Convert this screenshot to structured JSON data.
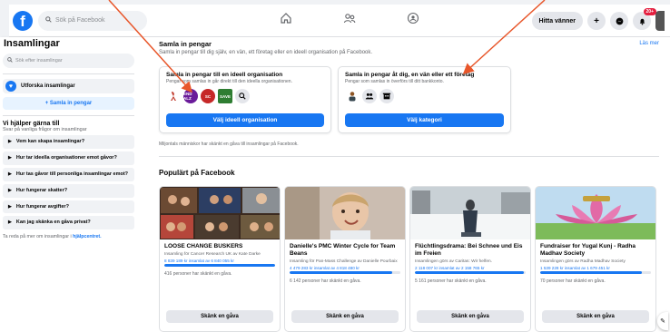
{
  "topbar": {
    "logo": "f",
    "search_placeholder": "Sök på Facebook",
    "find_friends": "Hitta vänner",
    "notification_count": "20+",
    "nav_icons": [
      "home-icon",
      "friends-icon",
      "groups-icon"
    ]
  },
  "sidebar": {
    "title": "Insamlingar",
    "search_placeholder": "Sök efter insamlingar",
    "explore_label": "Utforska insamlingar",
    "create_label": "+ Samla in pengar",
    "help_title": "Vi hjälper gärna till",
    "help_sub": "Svar på vanliga frågor om insamlingar",
    "faq": [
      "Vem kan skapa insamlingar?",
      "Hur tar ideella organisationer emot gåvor?",
      "Hur tas gåvor till personliga insamlingar emot?",
      "Hur fungerar skatter?",
      "Hur fungerar avgifter?",
      "Kan jag skänka en gåva privat?"
    ],
    "footer_text": "Ta reda på mer om insamlingar i ",
    "footer_link": "hjälpcentret."
  },
  "main": {
    "title": "Samla in pengar",
    "subtitle": "Samla in pengar till dig själv, en vän, ett företag eller en ideell organisation på Facebook.",
    "read_more": "Läs mer",
    "org_card": {
      "title": "Samla in pengar till en ideell organisation",
      "desc": "Pengar som samlas in går direkt till den ideella organisationen.",
      "logos": [
        "END ALZ",
        "SC",
        "SAVE"
      ],
      "button": "Välj ideell organisation"
    },
    "self_card": {
      "title": "Samla in pengar åt dig, en vän eller ett företag",
      "desc": "Pengar som samlas in överförs till ditt bankkonto.",
      "button": "Välj kategori"
    },
    "note": "Miljontals människor har skänkt en gåva till insamlingar på Facebook.",
    "popular_title": "Populärt på Facebook",
    "fundraisers": [
      {
        "title": "LOOSE CHANGE BUSKERS",
        "org": "Insamling för Cancer Research UK av Kate Darke",
        "raised": "8 839 189 kr insamlat av 6 840 055 kr",
        "progress": 1.0,
        "count": "416 personer har skänkt en gåva.",
        "button": "Skänk en gåva"
      },
      {
        "title": "Danielle's PMC Winter Cycle for Team Beans",
        "org": "Insamling för Pan-Mass Challenge av Danielle Pourbaix",
        "raised": "4 479 283 kr insamlat av 4 818 480 kr",
        "progress": 0.93,
        "count": "6 142 personer har skänkt en gåva.",
        "button": "Skänk en gåva"
      },
      {
        "title": "Flüchtlingsdrama: Bei Schnee und Eis im Freien",
        "org": "Insamlingen görs av Caritas: Wir helfen.",
        "raised": "2 118 007 kr insamlat av 2 158 765 kr",
        "progress": 0.98,
        "count": "5 161 personer har skänkt en gåva.",
        "button": "Skänk en gåva"
      },
      {
        "title": "Fundraiser for Yugal Kunj - Radha Madhav Society",
        "org": "Insamlingen görs av Radha Madhav Society",
        "raised": "1 539 228 kr insamlat av 1 679 451 kr",
        "progress": 0.92,
        "count": "70 personer har skänkt en gåva.",
        "button": "Skänk en gåva"
      }
    ]
  },
  "colors": {
    "brand_blue": "#1877f2",
    "annotation_arrow": "#e8562a"
  }
}
